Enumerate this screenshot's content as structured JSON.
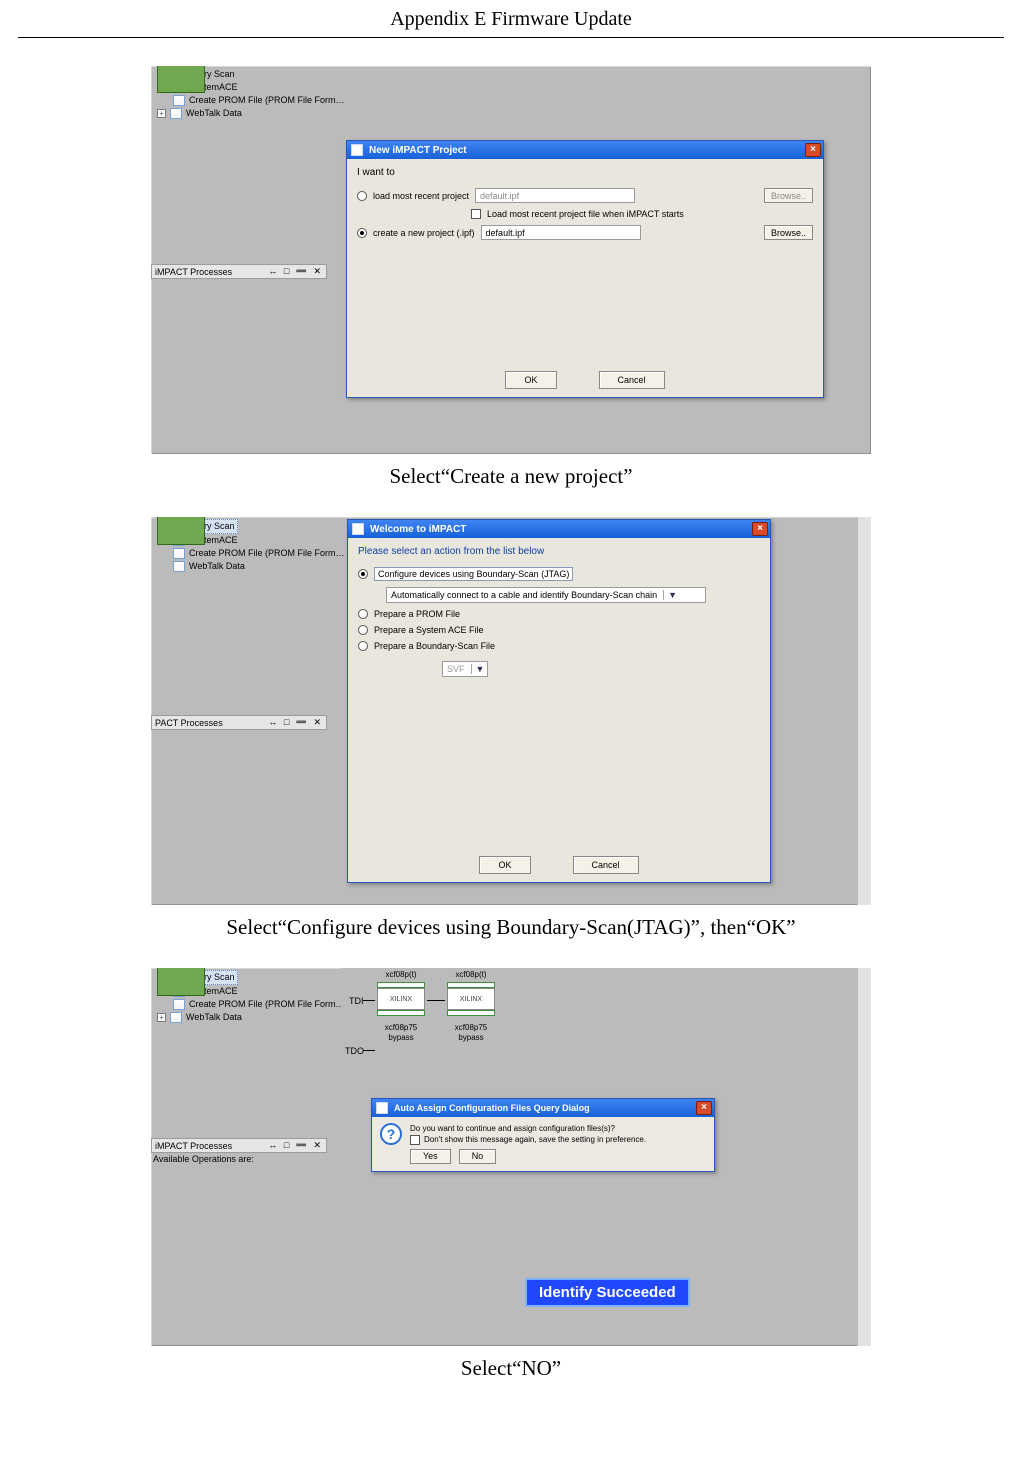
{
  "header": {
    "title": "Appendix E Firmware Update"
  },
  "captions": {
    "c1": "Select“Create a new project”",
    "c2": "Select“Configure devices using Boundary-Scan(JTAG)”, then“OK”",
    "c3": "Select“NO”"
  },
  "tree": {
    "items": {
      "boundary_scan": "Boundary Scan",
      "system_ace": "SystemACE",
      "create_prom": "Create PROM File (PROM File Form…",
      "webtalk": "WebTalk Data"
    }
  },
  "proc_header": {
    "label_impact": "iMPACT Processes",
    "label_pact": "PACT Processes",
    "glyphs": "↔ □ ➖ ✕"
  },
  "avail_ops": "Available Operations are:",
  "dialog1": {
    "title": "New iMPACT Project",
    "i_want_to": "I want to",
    "opt_load": "load most recent project",
    "load_field": "default.ipf",
    "browse": "Browse..",
    "chk_load_on_start": "Load most recent project file when iMPACT starts",
    "opt_create": "create a new project (.ipf)",
    "create_field": "default.ipf",
    "ok": "OK",
    "cancel": "Cancel"
  },
  "dialog2": {
    "title": "Welcome to iMPACT",
    "instr": "Please select an action from the list below",
    "opt_config": "Configure devices using Boundary-Scan (JTAG)",
    "dropdown": "Automatically connect to a cable and identify Boundary-Scan chain",
    "dd_arrow": "▼",
    "opt_prom": "Prepare a PROM File",
    "opt_ace": "Prepare a System ACE File",
    "opt_bsf": "Prepare a Boundary-Scan File",
    "svf_label": "SVF",
    "svf_arrow": "▼",
    "ok": "OK",
    "cancel": "Cancel"
  },
  "shot3": {
    "tdi": "TDI",
    "tdo": "TDO",
    "chip1_top": "xcf08p(t)",
    "chip1_body": "XILINX",
    "chip1_l1": "xcf08p75",
    "chip1_l2": "bypass",
    "chip2_top": "xcf08p(t)",
    "chip2_body": "XILINX",
    "chip2_l1": "xcf08p75",
    "chip2_l2": "bypass"
  },
  "dialog3": {
    "title": "Auto Assign Configuration Files Query Dialog",
    "qmark": "?",
    "line1": "Do you want to continue and assign configuration files(s)?",
    "line2": "Don't show this message again, save the setting in preference.",
    "yes": "Yes",
    "no": "No"
  },
  "succeed": "Identify Succeeded"
}
